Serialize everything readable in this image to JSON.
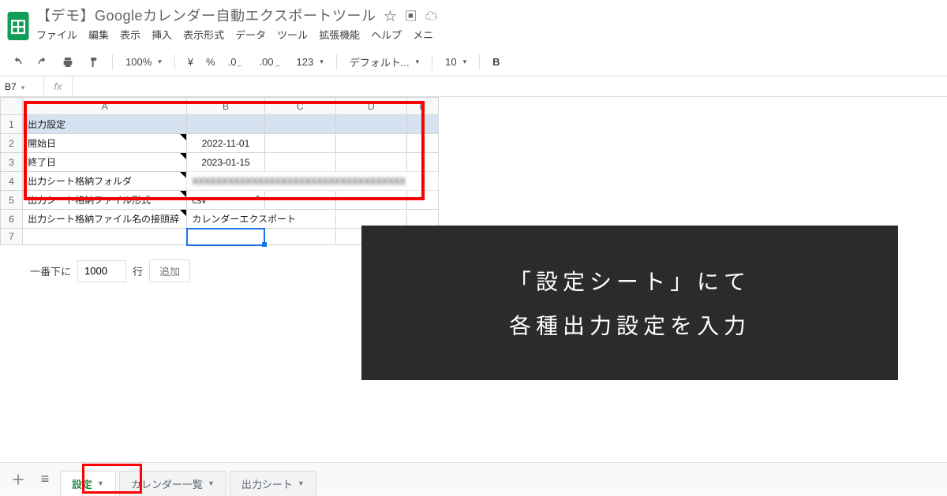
{
  "header": {
    "doc_title": "【デモ】Googleカレンダー自動エクスポートツール",
    "menus": [
      "ファイル",
      "編集",
      "表示",
      "挿入",
      "表示形式",
      "データ",
      "ツール",
      "拡張機能",
      "ヘルプ",
      "メニ"
    ]
  },
  "toolbar": {
    "zoom": "100%",
    "currency": "¥",
    "percent": "%",
    "dec_less": ".0",
    "dec_more": ".00",
    "num_fmt": "123",
    "font": "デフォルト...",
    "font_size": "10",
    "bold": "B"
  },
  "fx": {
    "cell": "B7",
    "label": "fx",
    "value": ""
  },
  "grid": {
    "columns": [
      "A",
      "B",
      "C",
      "D",
      "E"
    ],
    "rows": [
      {
        "n": "1",
        "a": "出力設定",
        "b": "",
        "selected": true
      },
      {
        "n": "2",
        "a": "開始日",
        "b": "2022-11-01",
        "note": true
      },
      {
        "n": "3",
        "a": "終了日",
        "b": "2023-01-15",
        "note": true
      },
      {
        "n": "4",
        "a": "出力シート格納フォルダ",
        "b": "XXXXXXXXXXXXXXXXXXXXXXXXXXXXXXXXXXXX",
        "note": true,
        "blur": true
      },
      {
        "n": "5",
        "a": "出力シート格納ファイル形式",
        "b": "csv",
        "note": true,
        "dd": true
      },
      {
        "n": "6",
        "a": "出力シート格納ファイル名の接頭辞",
        "b": "カレンダーエクスポート",
        "note": true
      },
      {
        "n": "7",
        "a": "",
        "b": "",
        "active": true
      }
    ]
  },
  "addrows": {
    "prefix": "一番下に",
    "count": "1000",
    "suffix": "行",
    "button": "追加"
  },
  "callout": {
    "line1": "「設定シート」にて",
    "line2": "各種出力設定を入力"
  },
  "tabs": {
    "items": [
      {
        "label": "設定",
        "active": true
      },
      {
        "label": "カレンダー一覧",
        "active": false
      },
      {
        "label": "出力シート",
        "active": false
      }
    ]
  }
}
